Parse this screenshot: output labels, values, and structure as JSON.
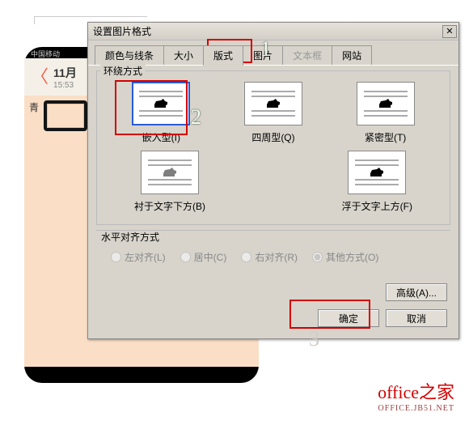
{
  "phone": {
    "carrier": "中国移动",
    "back_label": "11月",
    "time": "15:53",
    "side_text": "青"
  },
  "dialog": {
    "title": "设置图片格式",
    "close_glyph": "✕",
    "tabs": [
      {
        "label": "颜色与线条"
      },
      {
        "label": "大小"
      },
      {
        "label": "版式"
      },
      {
        "label": "图片"
      },
      {
        "label": "文本框"
      },
      {
        "label": "网站"
      }
    ],
    "wrap_group": "环绕方式",
    "wrap_options": [
      {
        "label": "嵌入型(I)"
      },
      {
        "label": "四周型(Q)"
      },
      {
        "label": "紧密型(T)"
      },
      {
        "label": "衬于文字下方(B)"
      },
      {
        "label": "浮于文字上方(F)"
      }
    ],
    "align_group": "水平对齐方式",
    "align_options": [
      "左对齐(L)",
      "居中(C)",
      "右对齐(R)",
      "其他方式(O)"
    ],
    "advanced": "高级(A)...",
    "ok": "确定",
    "cancel": "取消"
  },
  "annotation": {
    "n1": "1",
    "n2": "2",
    "n3": "3"
  },
  "watermark": {
    "line1": "office之家",
    "line2": "OFFICE.JB51.NET"
  }
}
